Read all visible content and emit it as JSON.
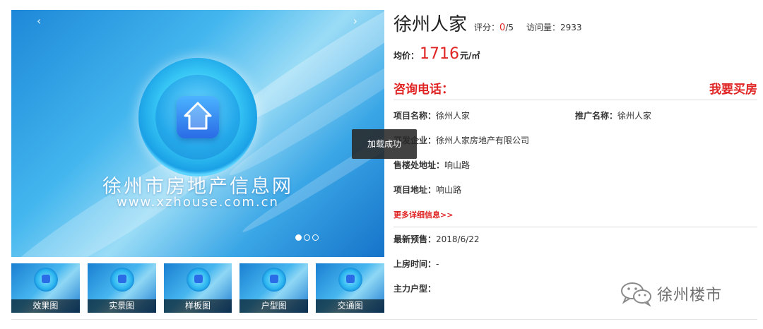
{
  "gallery": {
    "prev_arrow": "‹",
    "next_arrow": "›",
    "brand_title": "徐州市房地产信息网",
    "brand_url": "www.xzhouse.com.cn",
    "slides": 3,
    "active_slide": 1,
    "thumbnails": [
      "效果图",
      "实景图",
      "样板图",
      "户型图",
      "交通图"
    ]
  },
  "toast": "加载成功",
  "property": {
    "name": "徐州人家",
    "rating_label": "评分：",
    "rating_value": "0",
    "rating_max": "/5",
    "visits_label": "访问量：",
    "visits_value": "2933",
    "price_label": "均价：",
    "price_value": "1716",
    "price_unit": "元/㎡"
  },
  "contact": {
    "consult_label": "咨询电话：",
    "buy_link": "我要买房"
  },
  "details": {
    "project_name_label": "项目名称：",
    "project_name": "徐州人家",
    "promo_name_label": "推广名称：",
    "promo_name": "徐州人家",
    "developer_label": "开发企业：",
    "developer": "徐州人家房地产有限公司",
    "sales_address_label": "售楼处地址：",
    "sales_address": "响山路",
    "project_address_label": "项目地址：",
    "project_address": "响山路",
    "more_link": "更多详细信息>>",
    "presale_label": "最新预售：",
    "presale_date": "2018/6/22",
    "handover_label": "上房时间：",
    "handover_value": "-",
    "main_unit_label": "主力户型：",
    "main_unit_value": ""
  },
  "watermark": {
    "text": "徐州楼市",
    "icon": "wechat-icon"
  },
  "colors": {
    "accent_red": "#e02424",
    "toast_bg": "#282828"
  }
}
